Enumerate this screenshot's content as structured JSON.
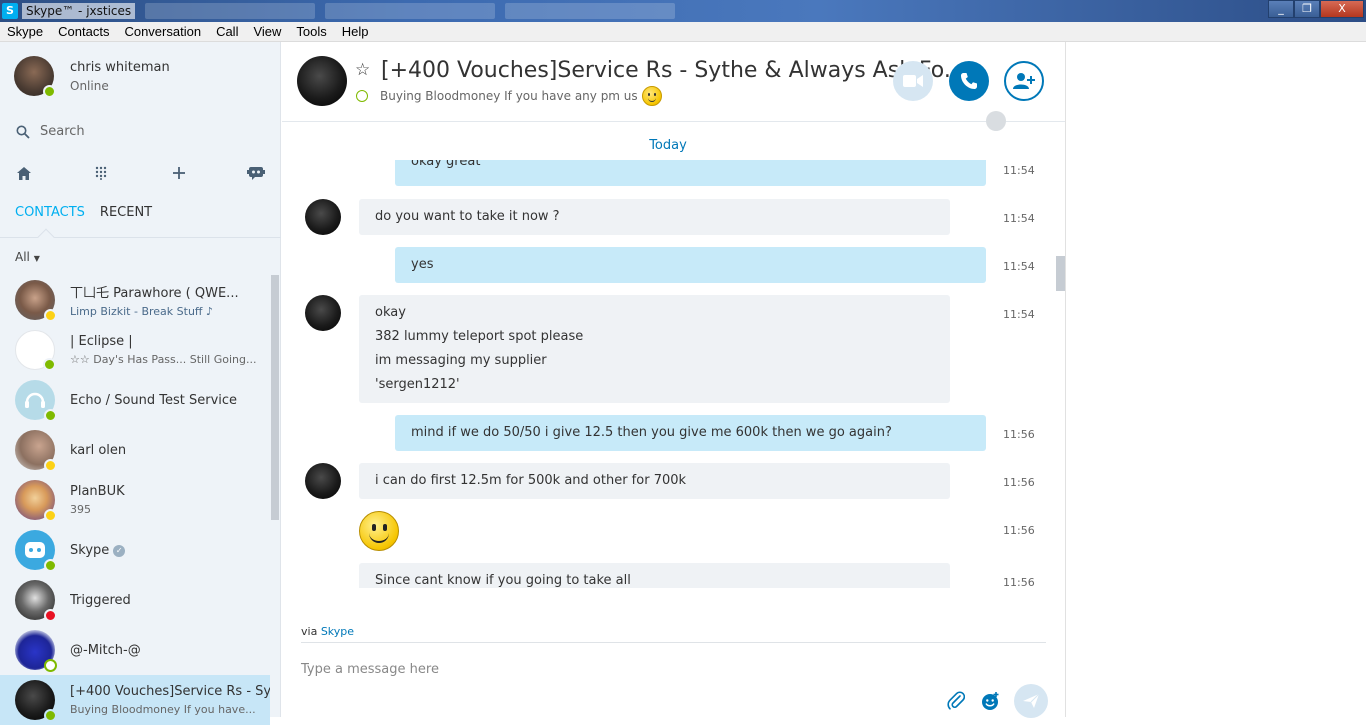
{
  "window": {
    "title": "Skype™ - jxstices",
    "app_icon_letter": "S",
    "minimize": "_",
    "maximize": "❐",
    "close": "X"
  },
  "menu": [
    "Skype",
    "Contacts",
    "Conversation",
    "Call",
    "View",
    "Tools",
    "Help"
  ],
  "profile": {
    "name": "chris whiteman",
    "status": "Online"
  },
  "search": {
    "label": "Search"
  },
  "tabs": {
    "contacts": "CONTACTS",
    "recent": "RECENT"
  },
  "filter": {
    "label": "All"
  },
  "contacts": [
    {
      "name": "丅凵乇 Parawhore ( QWE...",
      "mood": "Limp Bizkit - Break Stuff ♪",
      "presence": "away"
    },
    {
      "name": "| Eclipse |",
      "mood": "☆☆ Day's Has Pass... Still Going...",
      "presence": "online"
    },
    {
      "name": "Echo / Sound Test Service",
      "mood": "",
      "presence": "online"
    },
    {
      "name": "karl olen",
      "mood": "",
      "presence": "away"
    },
    {
      "name": "PlanBUK",
      "mood": "395",
      "presence": "away"
    },
    {
      "name": "Skype",
      "mood": "",
      "presence": "online"
    },
    {
      "name": "Triggered",
      "mood": "",
      "presence": "dnd"
    },
    {
      "name": "@-Mitch-@",
      "mood": "",
      "presence": "offline"
    },
    {
      "name": "[+400 Vouches]Service Rs - Sy...",
      "mood": "Buying Bloodmoney If you have...",
      "presence": "online"
    }
  ],
  "conversation": {
    "title": "[+400 Vouches]Service Rs - Sythe & Always Ask Fo...",
    "mood": "Buying Bloodmoney If you have any pm us",
    "day_label": "Today",
    "messages": [
      {
        "dir": "out",
        "lines": [
          "okay great"
        ],
        "time": "11:54"
      },
      {
        "dir": "in",
        "lines": [
          "do you want to take it now ?"
        ],
        "time": "11:54"
      },
      {
        "dir": "out",
        "lines": [
          "yes"
        ],
        "time": "11:54"
      },
      {
        "dir": "in",
        "lines": [
          "okay",
          "382 lummy teleport spot please",
          "im messaging my supplier",
          "'sergen1212'"
        ],
        "time": "11:54"
      },
      {
        "dir": "out",
        "lines": [
          "mind if we do 50/50 i give 12.5 then you give me 600k then we go again?"
        ],
        "time": "11:56"
      },
      {
        "dir": "in",
        "lines": [
          "i can do first 12.5m for 500k and other for 700k"
        ],
        "time": "11:56"
      },
      {
        "dir": "in",
        "lines": [],
        "emoji": "smile",
        "time": "11:56"
      },
      {
        "dir": "in",
        "lines": [
          "Since cant know if you going to take all"
        ],
        "time": "11:56"
      }
    ],
    "via_prefix": "via",
    "via_link": "Skype",
    "compose_placeholder": "Type a message here"
  },
  "colors": {
    "accent": "#00aff0",
    "call_blue": "#0078b8",
    "incoming_bubble": "#eff2f5",
    "outgoing_bubble": "#c7eaf9",
    "sidebar_bg": "#eef3f8"
  },
  "icons": [
    "home-icon",
    "dialpad-icon",
    "plus-icon",
    "bot-icon",
    "search-icon",
    "star-icon",
    "video-icon",
    "phone-icon",
    "add-contact-icon",
    "attach-icon",
    "emoticon-icon",
    "send-icon",
    "globe-icon"
  ]
}
